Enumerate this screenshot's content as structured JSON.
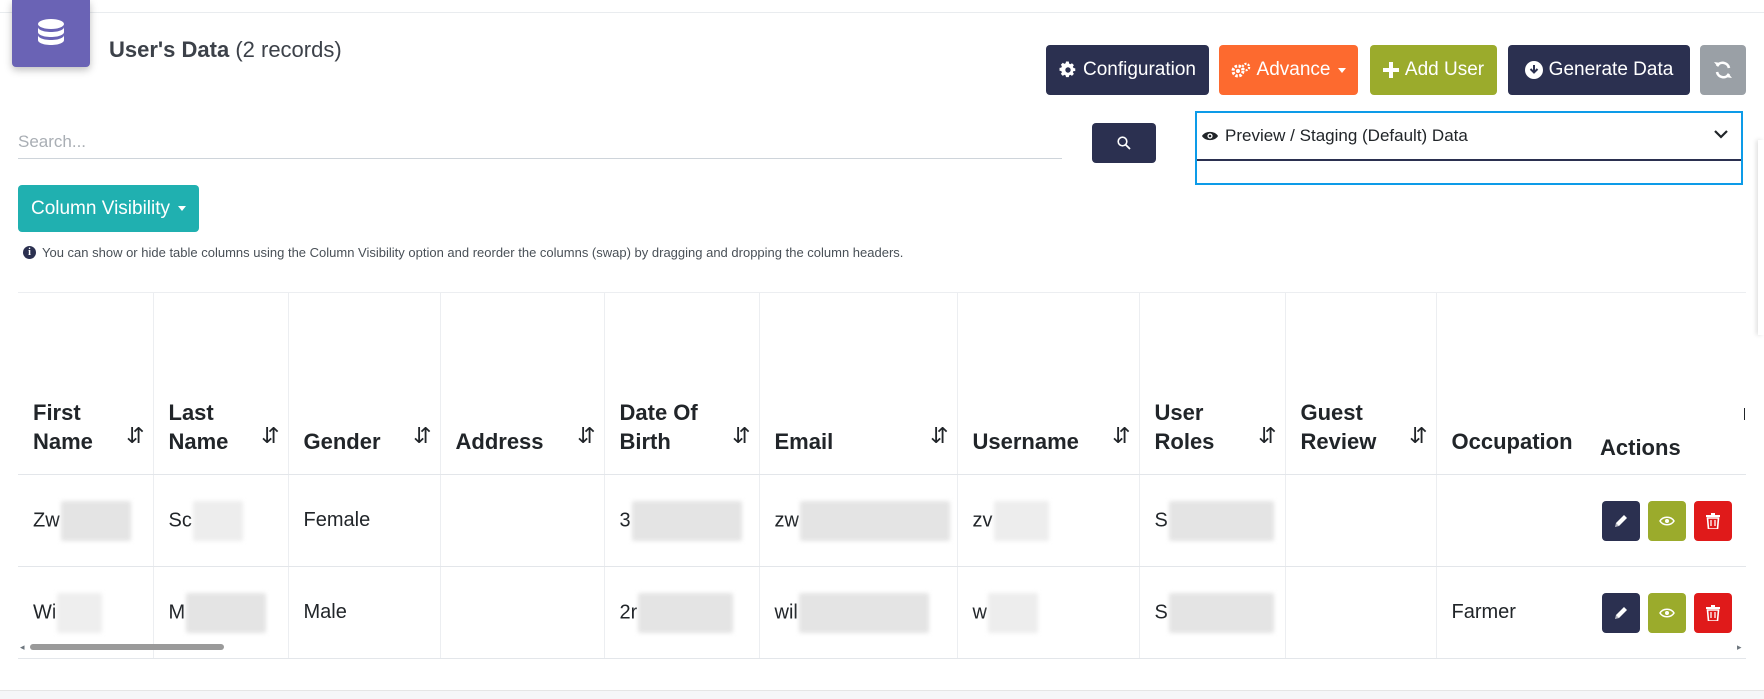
{
  "header": {
    "db_icon": "database-icon",
    "title_bold": "User's Data",
    "title_count": "(2 records)"
  },
  "toolbar": {
    "configuration_label": "Configuration",
    "advance_label": "Advance",
    "add_user_label": "Add User",
    "generate_label": "Generate Data",
    "refresh_icon": "refresh-icon"
  },
  "search": {
    "placeholder": "Search...",
    "value": ""
  },
  "data_source": {
    "selected": "Preview / Staging (Default) Data"
  },
  "column_visibility": {
    "label": "Column Visibility"
  },
  "info": {
    "text": "You can show or hide table columns using the Column Visibility option and reorder the columns (swap) by dragging and dropping the column headers."
  },
  "table": {
    "columns": [
      {
        "label": "First Name",
        "sortable": true
      },
      {
        "label": "Last Name",
        "sortable": true
      },
      {
        "label": "Gender",
        "sortable": true
      },
      {
        "label": "Address",
        "sortable": true
      },
      {
        "label": "Date Of Birth",
        "sortable": true
      },
      {
        "label": "Email",
        "sortable": true
      },
      {
        "label": "Username",
        "sortable": true
      },
      {
        "label": "User Roles",
        "sortable": true
      },
      {
        "label": "Guest Review",
        "sortable": true
      },
      {
        "label": "Occupation",
        "sortable": false
      },
      {
        "label": "Actions",
        "sortable": false
      }
    ],
    "sort_icon": "⇵",
    "rows": [
      {
        "first_name": "Zw",
        "last_name": "Sc",
        "gender": "Female",
        "address": "",
        "dob": "3",
        "email": "zw",
        "username": "zv",
        "user_roles": "S",
        "guest_review": "",
        "occupation": ""
      },
      {
        "first_name": "Wi",
        "last_name": "M",
        "gender": "Male",
        "address": "",
        "dob": "2r",
        "email": "wil",
        "username": "w",
        "user_roles": "S",
        "guest_review": "",
        "occupation": "Farmer"
      }
    ]
  },
  "colors": {
    "navy": "#2b3050",
    "orange": "#fd6a2f",
    "olive": "#9bab2c",
    "teal": "#20b0b0",
    "red": "#e01a1a",
    "purple": "#6a63b5",
    "focus_blue": "#0d9be8"
  }
}
